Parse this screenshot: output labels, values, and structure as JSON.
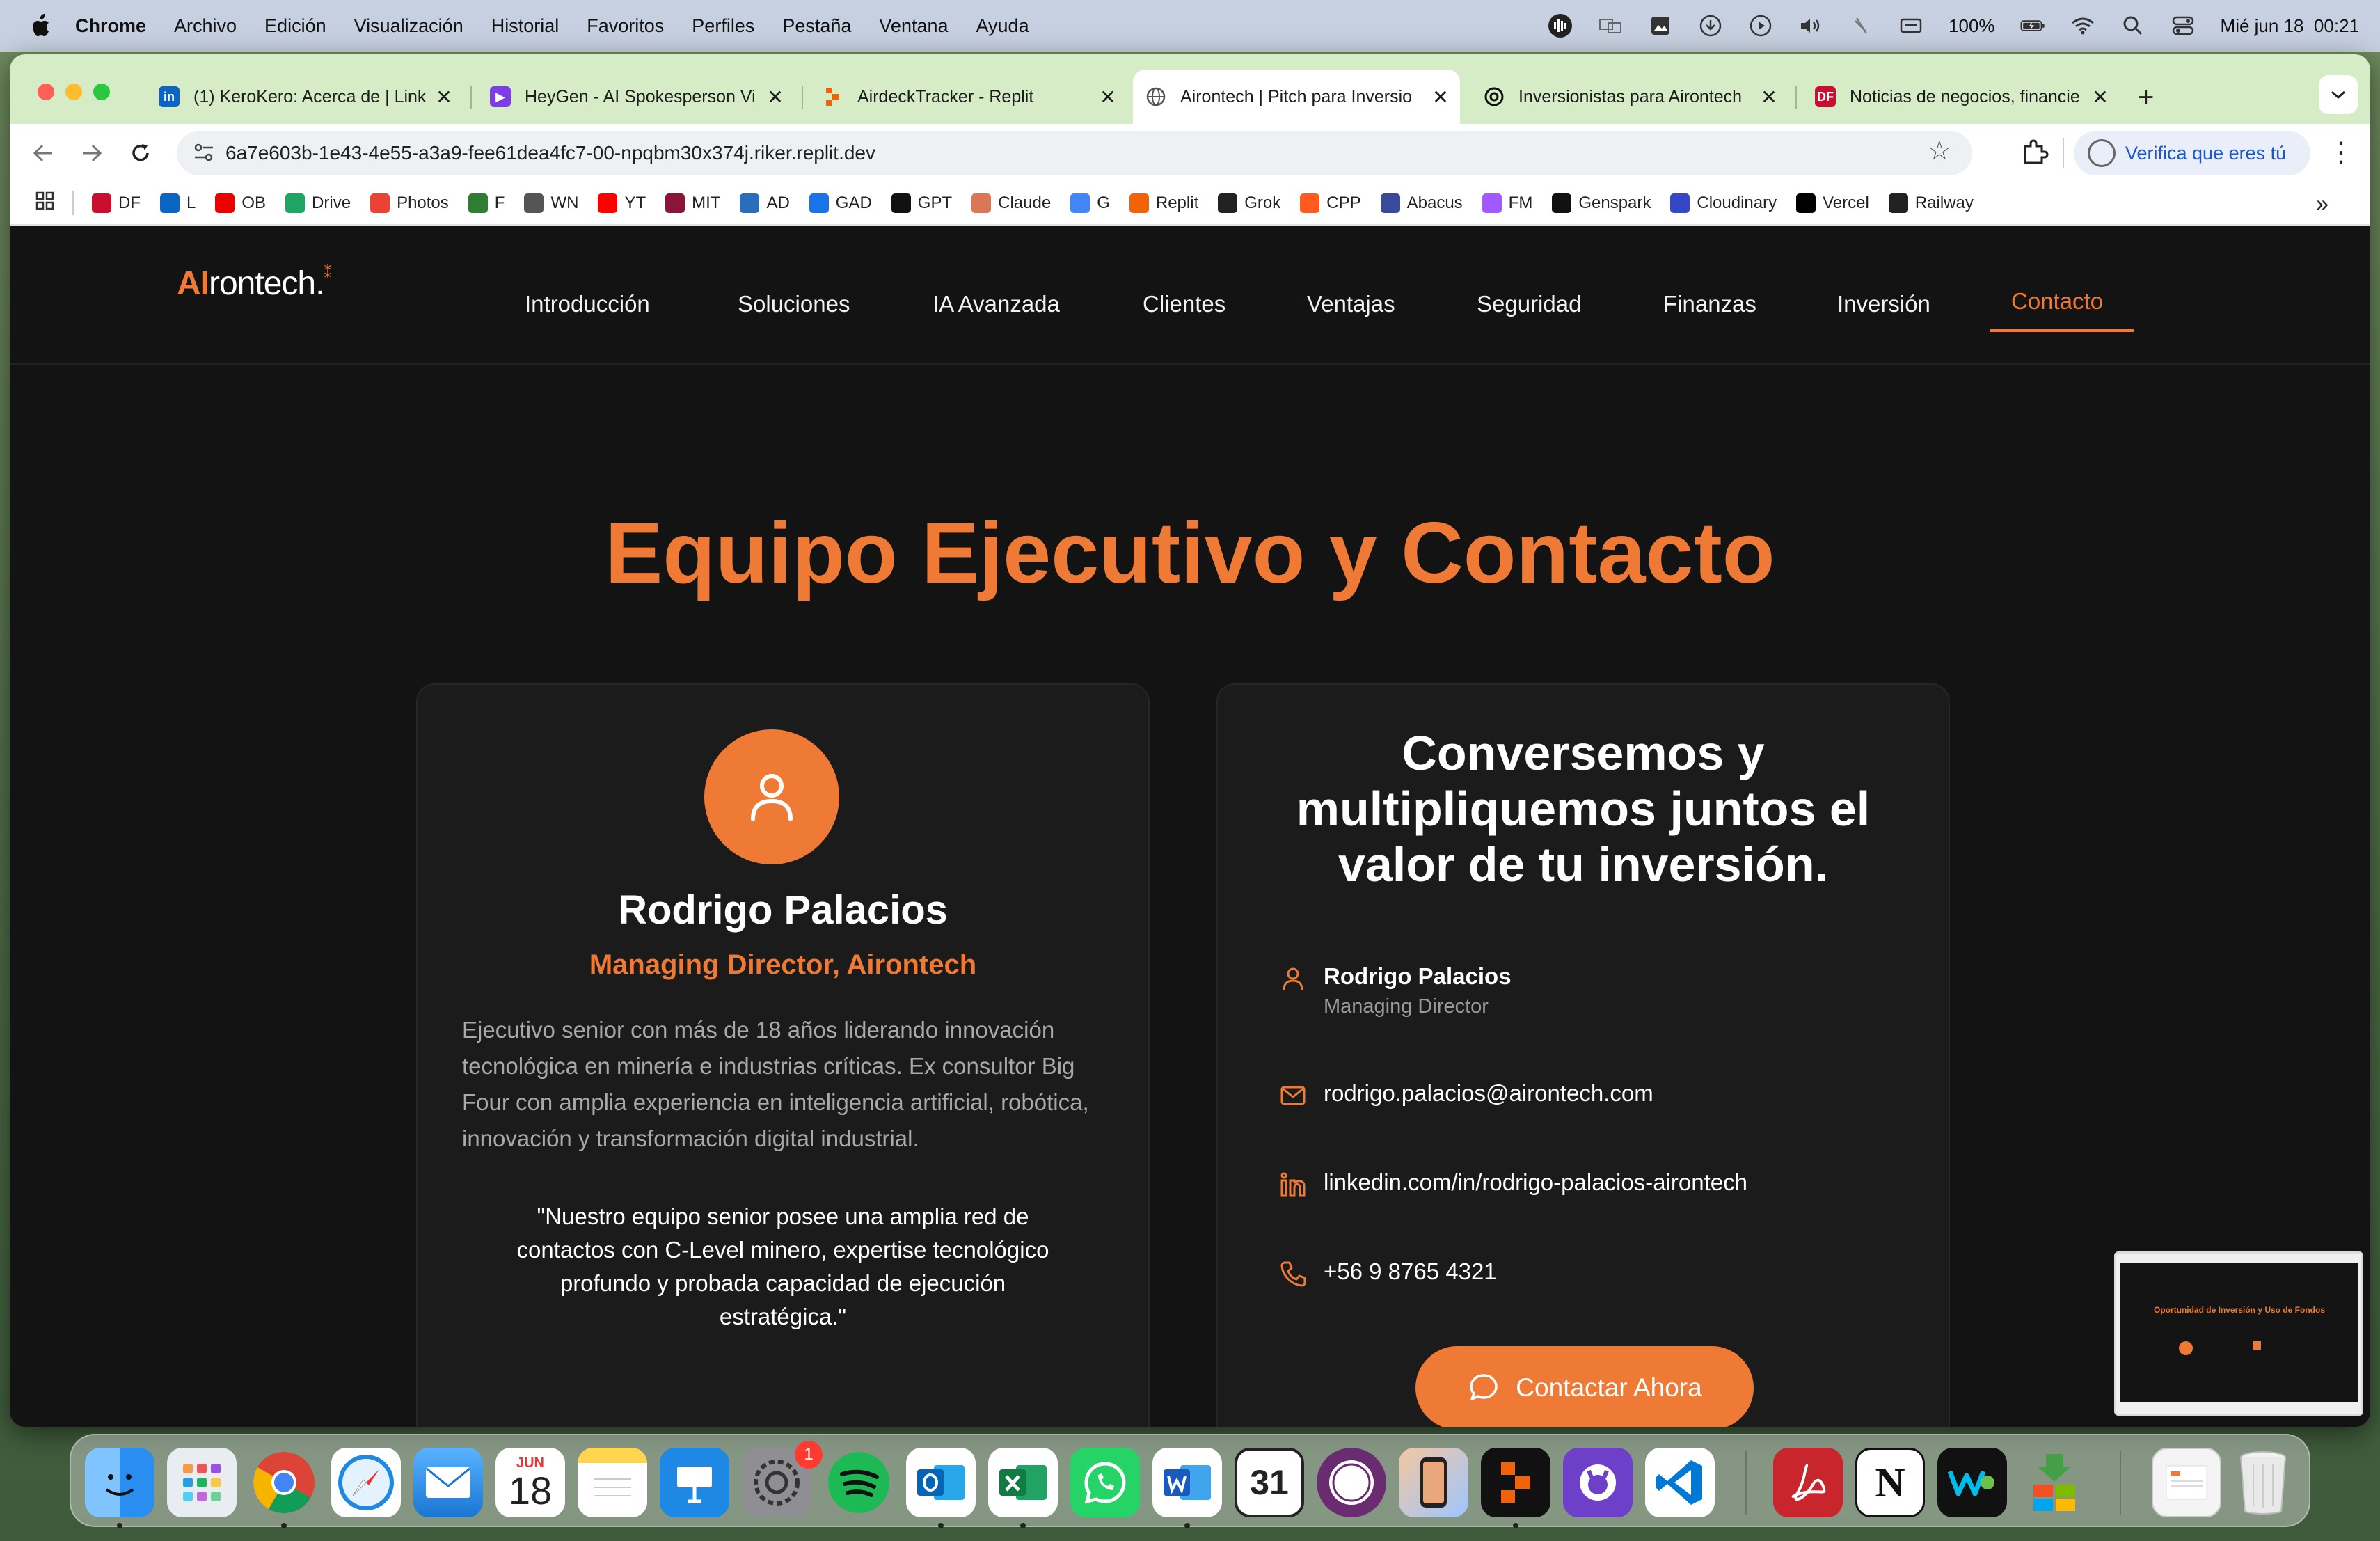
{
  "menubar": {
    "app_name": "Chrome",
    "items": [
      "Archivo",
      "Edición",
      "Visualización",
      "Historial",
      "Favoritos",
      "Perfiles",
      "Pestaña",
      "Ventana",
      "Ayuda"
    ],
    "battery": "100%",
    "datetime": "Mié jun 18  00:21"
  },
  "browser": {
    "tabs": [
      {
        "title": "(1) KeroKero: Acerca de | Link",
        "icon": "linkedin-icon",
        "color": "#0a66c2"
      },
      {
        "title": "HeyGen - AI Spokesperson Vi",
        "icon": "heygen-icon",
        "color": "#7b3fe4"
      },
      {
        "title": "AirdeckTracker - Replit",
        "icon": "replit-icon",
        "color": "#f26207"
      },
      {
        "title": "Airontech | Pitch para Inversio",
        "icon": "globe-icon",
        "color": "#555555"
      },
      {
        "title": "Inversionistas para Airontech",
        "icon": "chatgpt-icon",
        "color": "#111111"
      },
      {
        "title": "Noticias de negocios, financie",
        "icon": "df-icon",
        "color": "#c8102e"
      }
    ],
    "url": "6a7e603b-1e43-4e55-a3a9-fee61dea4fc7-00-npqbm30x374j.riker.replit.dev",
    "verify_label": "Verifica que eres tú",
    "bookmarks": [
      {
        "label": "DF",
        "color": "#c8102e"
      },
      {
        "label": "L",
        "color": "#0a66c2"
      },
      {
        "label": "OB",
        "color": "#ec0000"
      },
      {
        "label": "Drive",
        "color": "#1fa463"
      },
      {
        "label": "Photos",
        "color": "#ea4335"
      },
      {
        "label": "F",
        "color": "#2e7d32"
      },
      {
        "label": "WN",
        "color": "#555555"
      },
      {
        "label": "YT",
        "color": "#ff0000"
      },
      {
        "label": "MIT",
        "color": "#8a1538"
      },
      {
        "label": "AD",
        "color": "#2a6ebb"
      },
      {
        "label": "GAD",
        "color": "#1a73e8"
      },
      {
        "label": "GPT",
        "color": "#111111"
      },
      {
        "label": "Claude",
        "color": "#d97757"
      },
      {
        "label": "G",
        "color": "#4285f4"
      },
      {
        "label": "Replit",
        "color": "#f26207"
      },
      {
        "label": "Grok",
        "color": "#222222"
      },
      {
        "label": "CPP",
        "color": "#ff5a1f"
      },
      {
        "label": "Abacus",
        "color": "#3a4a9a"
      },
      {
        "label": "FM",
        "color": "#a259ff"
      },
      {
        "label": "Genspark",
        "color": "#111111"
      },
      {
        "label": "Cloudinary",
        "color": "#3448c5"
      },
      {
        "label": "Vercel",
        "color": "#000000"
      },
      {
        "label": "Railway",
        "color": "#222222"
      }
    ],
    "more": "»"
  },
  "site": {
    "logo_ai": "AI",
    "logo_rest": "rontech.",
    "nav": [
      "Introducción",
      "Soluciones",
      "IA Avanzada",
      "Clientes",
      "Ventajas",
      "Seguridad",
      "Finanzas",
      "Inversión",
      "Contacto"
    ],
    "active_nav": "Contacto",
    "accent": "#ef7a35",
    "section_title": "Equipo Ejecutivo y Contacto",
    "person": {
      "name": "Rodrigo Palacios",
      "role": "Managing Director, Airontech",
      "bio": "Ejecutivo senior con más de 18 años liderando innovación tecnológica en minería e industrias críticas. Ex consultor Big Four con amplia experiencia en inteligencia artificial, robótica, innovación y transformación digital industrial.",
      "quote": "\"Nuestro equipo senior posee una amplia red de contactos con C-Level minero, expertise tecnológico profundo y probada capacidad de ejecución estratégica.\""
    },
    "contact": {
      "title": "Conversemos y multipliquemos juntos el valor de tu inversión.",
      "name": "Rodrigo Palacios",
      "title_role": "Managing Director",
      "email": "rodrigo.palacios@airontech.com",
      "linkedin": "linkedin.com/in/rodrigo-palacios-airontech",
      "phone": "+56 9 8765 4321",
      "button": "Contactar Ahora"
    }
  },
  "thumbnail": {
    "title": "Oportunidad de Inversión y Uso de Fondos"
  },
  "dock": {
    "calendar_month": "JUN",
    "calendar_day": "18",
    "settings_badge": "1",
    "apps": [
      "finder-icon",
      "launchpad-icon",
      "chrome-icon",
      "safari-icon",
      "mail-icon",
      "calendar-icon",
      "notes-icon",
      "keynote-icon",
      "system-settings-icon",
      "spotify-icon",
      "outlook-icon",
      "excel-icon",
      "whatsapp-icon",
      "word-icon",
      "fantastical-icon",
      "screen-recorder-icon",
      "iphone-mirroring-icon",
      "replit-icon",
      "github-desktop-icon",
      "vscode-icon",
      "acrobat-icon",
      "notion-icon",
      "webex-icon",
      "installer-icon",
      "document-icon",
      "trash-icon"
    ]
  }
}
